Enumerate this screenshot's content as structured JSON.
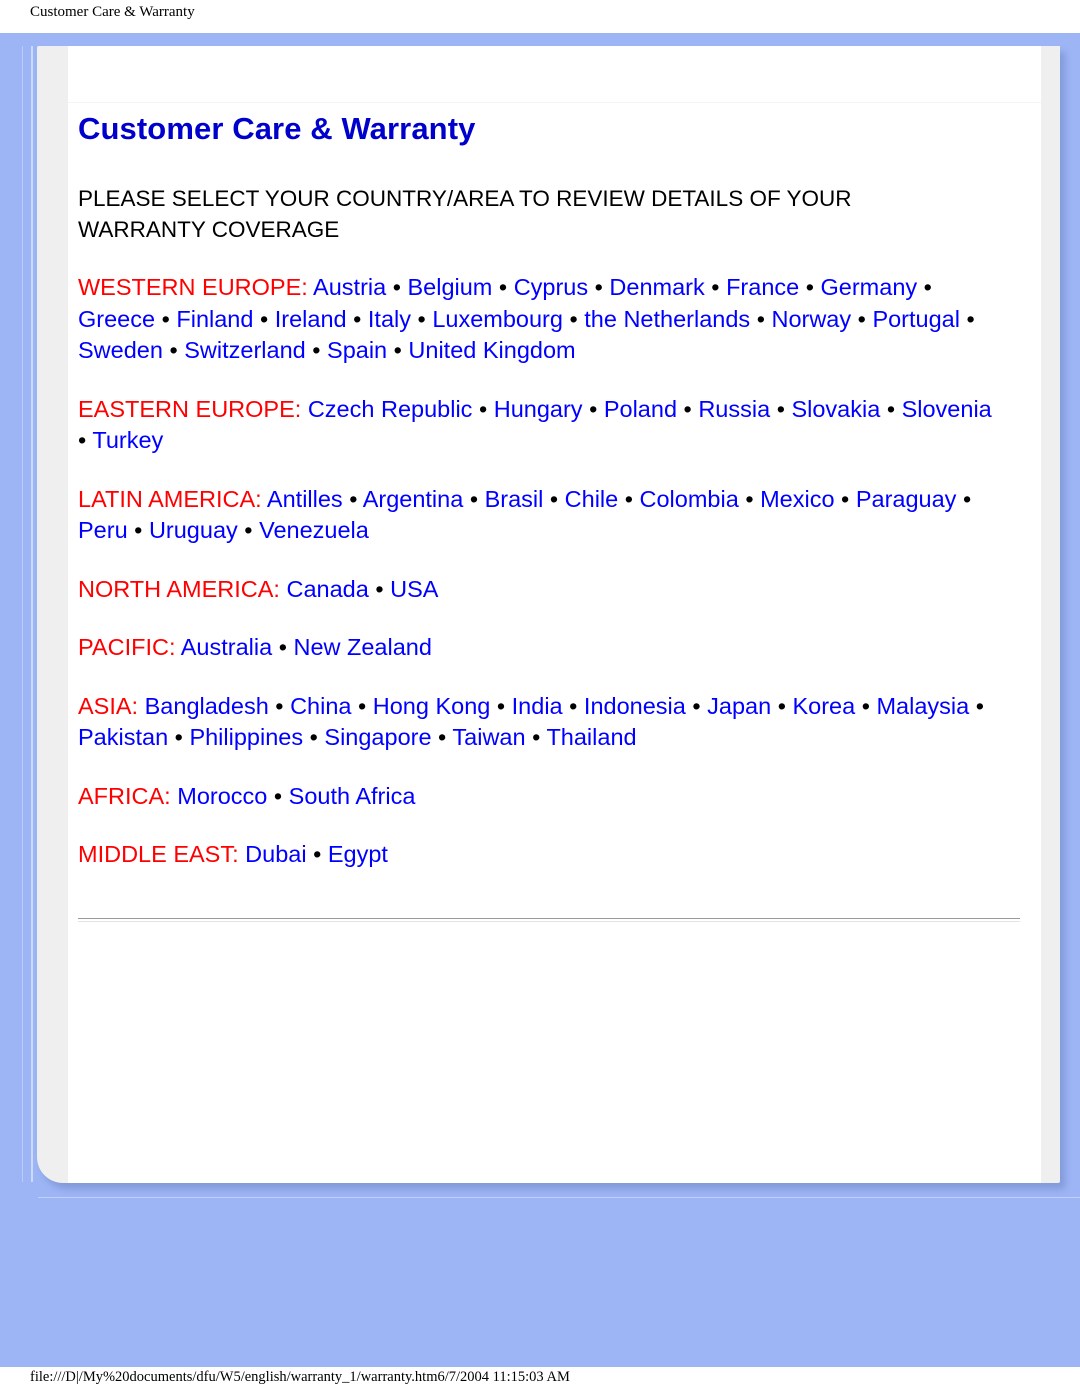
{
  "print_header": {
    "title": "Customer Care & Warranty"
  },
  "print_footer": {
    "path_and_timestamp": "file:///D|/My%20documents/dfu/W5/english/warranty_1/warranty.htm6/7/2004 11:15:03 AM"
  },
  "colors": {
    "page_background": "#9db5f5",
    "card_background": "#efefef",
    "sheet_background": "#ffffff",
    "title": "#0000cc",
    "region_label": "#ff0000",
    "link": "#0000ff",
    "body_text": "#000000"
  },
  "document": {
    "title": "Customer Care & Warranty",
    "instruction": "PLEASE SELECT YOUR COUNTRY/AREA TO REVIEW DETAILS OF YOUR WARRANTY COVERAGE",
    "separator": "•",
    "regions": [
      {
        "label": "WESTERN EUROPE:",
        "countries": [
          "Austria",
          "Belgium",
          "Cyprus",
          "Denmark",
          "France",
          "Germany",
          "Greece",
          "Finland",
          "Ireland",
          "Italy",
          "Luxembourg",
          "the Netherlands",
          "Norway",
          "Portugal",
          "Sweden",
          "Switzerland",
          "Spain",
          "United Kingdom"
        ]
      },
      {
        "label": "EASTERN EUROPE:",
        "countries": [
          "Czech Republic",
          "Hungary",
          "Poland",
          "Russia",
          "Slovakia",
          "Slovenia",
          "Turkey"
        ]
      },
      {
        "label": "LATIN AMERICA:",
        "countries": [
          "Antilles",
          "Argentina",
          "Brasil",
          "Chile",
          "Colombia",
          "Mexico",
          "Paraguay",
          "Peru",
          "Uruguay",
          "Venezuela"
        ]
      },
      {
        "label": "NORTH AMERICA:",
        "countries": [
          "Canada",
          "USA"
        ]
      },
      {
        "label": "PACIFIC:",
        "countries": [
          "Australia",
          "New Zealand"
        ]
      },
      {
        "label": "ASIA:",
        "countries": [
          "Bangladesh",
          "China",
          "Hong Kong",
          "India",
          "Indonesia",
          "Japan",
          "Korea",
          "Malaysia",
          "Pakistan",
          "Philippines",
          "Singapore",
          "Taiwan",
          "Thailand"
        ]
      },
      {
        "label": "AFRICA:",
        "countries": [
          "Morocco",
          "South Africa"
        ]
      },
      {
        "label": "MIDDLE EAST:",
        "countries": [
          "Dubai",
          "Egypt"
        ]
      }
    ]
  }
}
